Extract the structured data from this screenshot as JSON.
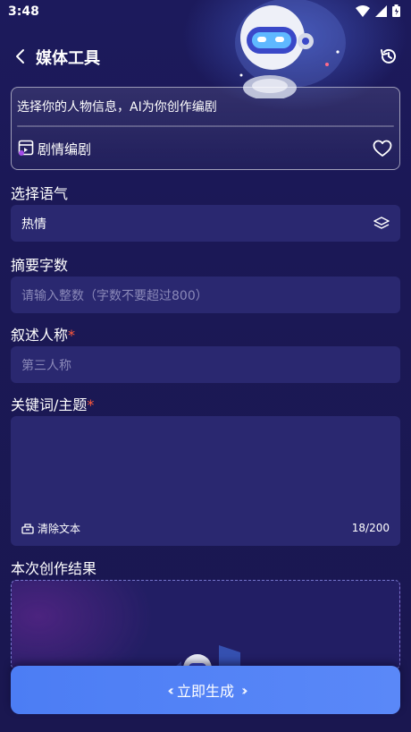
{
  "status_bar": {
    "time": "3:48"
  },
  "header": {
    "title": "媒体工具"
  },
  "prompt_card": {
    "prompt_text": "选择你的人物信息，AI为你创作编剧",
    "mode_label": "剧情编剧"
  },
  "tone": {
    "label": "选择语气",
    "value": "热情"
  },
  "summary_count": {
    "label": "摘要字数",
    "placeholder": "请输入整数（字数不要超过800）"
  },
  "narrator": {
    "label": "叙述人称",
    "required_mark": "*",
    "placeholder": "第三人称"
  },
  "keywords": {
    "label": "关键词/主题",
    "required_mark": "*",
    "clear_label": "清除文本",
    "counter": "18/200"
  },
  "result": {
    "label": "本次创作结果"
  },
  "generate": {
    "label": "立即生成"
  },
  "colors": {
    "background": "#1a1750",
    "field": "#2a2870",
    "accent": "#4c7df4",
    "required": "#ff5a3c"
  },
  "icons": [
    "back-icon",
    "history-icon",
    "script-icon",
    "heart-icon",
    "layers-icon",
    "clear-icon"
  ]
}
